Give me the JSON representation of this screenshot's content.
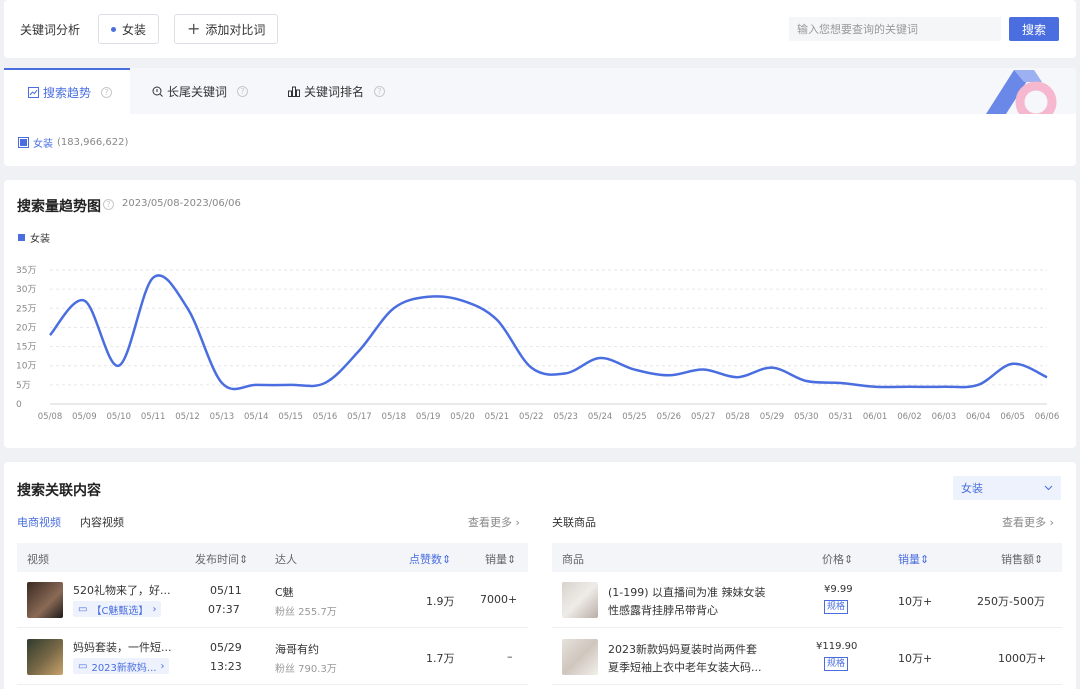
{
  "topbar": {
    "label": "关键词分析",
    "keyword_chip": "女装",
    "add_compare": "添加对比词",
    "search_placeholder": "输入您想要查询的关键词",
    "search_button": "搜索"
  },
  "tabs": [
    {
      "label": "搜索趋势",
      "icon": "trend-icon",
      "active": true
    },
    {
      "label": "长尾关键词",
      "icon": "search-detail-icon",
      "active": false
    },
    {
      "label": "关键词排名",
      "icon": "bar-chart-icon",
      "active": false
    }
  ],
  "keyword_legend": {
    "name": "女装",
    "count": "(183,966,622)"
  },
  "trend": {
    "title": "搜索量趋势图",
    "date_range": "2023/05/08-2023/06/06",
    "legend": "女装"
  },
  "chart_data": {
    "type": "line",
    "series": [
      {
        "name": "女装",
        "values": [
          18,
          27,
          10,
          33,
          25,
          5.5,
          5,
          5,
          5.5,
          14,
          25,
          28,
          27,
          22,
          9.5,
          8,
          12,
          9,
          7.5,
          9,
          7,
          9.5,
          6,
          5.5,
          4.5,
          4.5,
          4.5,
          5,
          10.5,
          7
        ],
        "color": "#4a6ee0"
      }
    ],
    "categories": [
      "05/08",
      "05/09",
      "05/10",
      "05/11",
      "05/12",
      "05/13",
      "05/14",
      "05/15",
      "05/16",
      "05/17",
      "05/18",
      "05/19",
      "05/20",
      "05/21",
      "05/22",
      "05/23",
      "05/24",
      "05/25",
      "05/26",
      "05/27",
      "05/28",
      "05/29",
      "05/30",
      "05/31",
      "06/01",
      "06/02",
      "06/03",
      "06/04",
      "06/05",
      "06/06"
    ],
    "yticks": [
      "0",
      "5万",
      "10万",
      "15万",
      "20万",
      "25万",
      "30万",
      "35万"
    ],
    "ylim": [
      0,
      35
    ],
    "grid": true,
    "unit": "万"
  },
  "related": {
    "title": "搜索关联内容",
    "select_value": "女装",
    "subtabs": [
      "电商视频",
      "内容视频"
    ],
    "more_left": "查看更多",
    "goods_title": "关联商品",
    "more_right": "查看更多",
    "video_headers": [
      "视频",
      "发布时间",
      "达人",
      "点赞数",
      "销量"
    ],
    "goods_headers": [
      "商品",
      "价格",
      "销量",
      "销售额"
    ],
    "videos": [
      {
        "title": "520礼物来了，好...",
        "tag": "【C魅甄选】",
        "date": "05/11",
        "time": "07:37",
        "creator": "C魅",
        "fans": "粉丝 255.7万",
        "likes": "1.9万",
        "sales": "7000+"
      },
      {
        "title": "妈妈套装，一件短...",
        "tag": "2023新款妈...",
        "date": "05/29",
        "time": "13:23",
        "creator": "海哥有约",
        "fans": "粉丝 790.3万",
        "likes": "1.7万",
        "sales": "–"
      }
    ],
    "goods": [
      {
        "line1": "(1-199) 以直播间为准 辣妹女装",
        "line2": "性感露背挂脖吊带背心",
        "price": "¥9.99",
        "spec": "规格",
        "sales": "10万+",
        "revenue": "250万-500万"
      },
      {
        "line1": "2023新款妈妈夏装时尚两件套",
        "line2": "夏季短袖上衣中老年女装大码...",
        "price": "¥119.90",
        "spec": "规格",
        "sales": "10万+",
        "revenue": "1000万+"
      }
    ]
  }
}
